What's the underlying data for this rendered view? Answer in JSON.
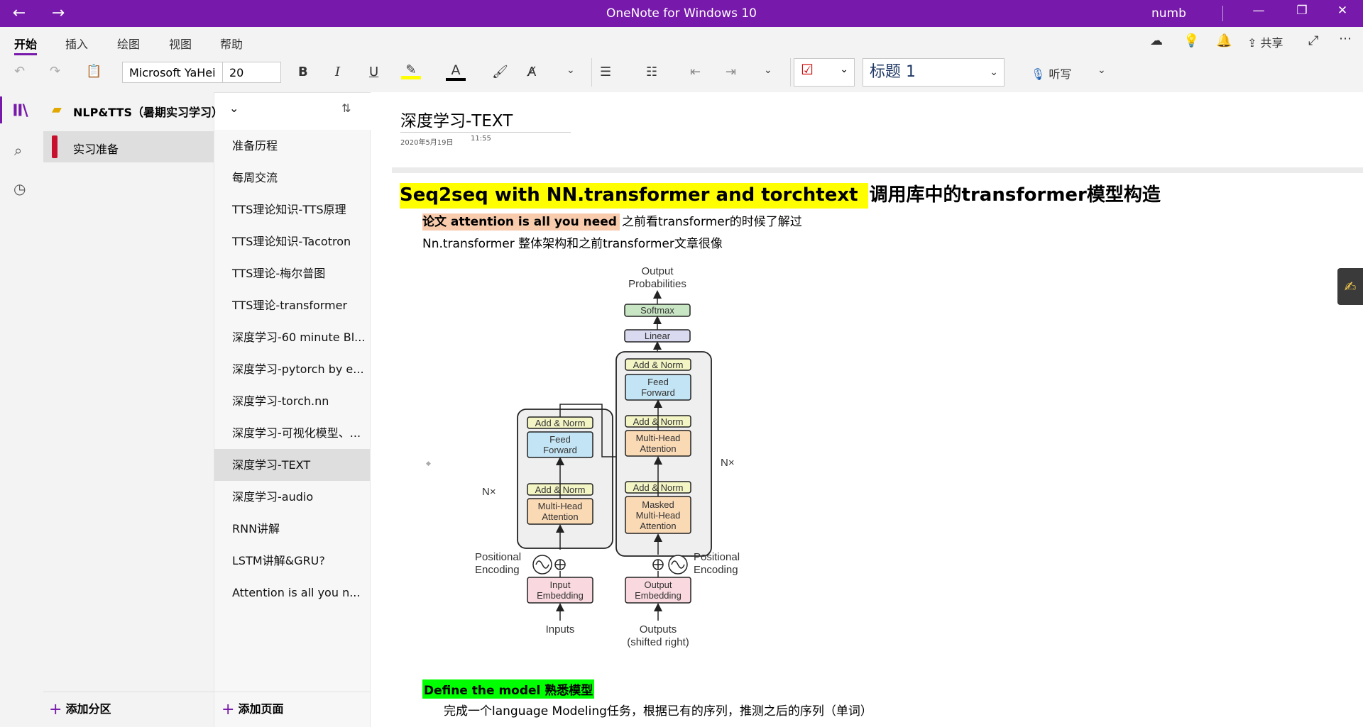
{
  "window": {
    "title": "OneNote for Windows 10",
    "user": "numb"
  },
  "ribbon": {
    "tabs": [
      "开始",
      "插入",
      "绘图",
      "视图",
      "帮助"
    ],
    "share_label": "共享",
    "font_name": "Microsoft YaHei",
    "font_size": "20",
    "style": "标题 1",
    "dictate_label": "听写"
  },
  "notebook": {
    "name": "NLP&TTS（暑期实习学习）",
    "section": "实习准备",
    "add_section_label": "添加分区",
    "add_page_label": "添加页面",
    "section_color": "#c8102e"
  },
  "pages": [
    "准备历程",
    "每周交流",
    "TTS理论知识-TTS原理",
    "TTS理论知识-Tacotron",
    "TTS理论-梅尔普图",
    "TTS理论-transformer",
    "深度学习-60 minute Bl...",
    "深度学习-pytorch by e...",
    "深度学习-torch.nn",
    "深度学习-可视化模型、...",
    "深度学习-TEXT",
    "深度学习-audio",
    "RNN讲解",
    "LSTM讲解&GRU?",
    "Attention is all you n..."
  ],
  "selected_page_index": 10,
  "note": {
    "title": "深度学习-TEXT",
    "date": "2020年5月19日",
    "time": "11:55",
    "heading_highlight": "Seq2seq with NN.transformer and torchtext",
    "heading_rest": "调用库中的transformer模型构造",
    "line1_highlight": "论文 attention is all you need",
    "line1_rest": "之前看transformer的时候了解过",
    "line2": "Nn.transformer 整体架构和之前transformer文章很像",
    "define_highlight": "Define the model 熟悉模型",
    "define_text": "完成一个language Modeling任务，根据已有的序列，推测之后的序列（单词）"
  },
  "diagram": {
    "output_prob": [
      "Output",
      "Probabilities"
    ],
    "softmax": "Softmax",
    "linear": "Linear",
    "add_norm": "Add & Norm",
    "feed_forward": [
      "Feed",
      "Forward"
    ],
    "mha": [
      "Multi-Head",
      "Attention"
    ],
    "masked_mha": [
      "Masked",
      "Multi-Head",
      "Attention"
    ],
    "nx": "N×",
    "pos_enc": [
      "Positional",
      "Encoding"
    ],
    "input_emb": [
      "Input",
      "Embedding"
    ],
    "output_emb": [
      "Output",
      "Embedding"
    ],
    "inputs": "Inputs",
    "outputs": [
      "Outputs",
      "(shifted right)"
    ]
  },
  "colors": {
    "accent": "#7719aa",
    "yellow_highlight": "#ffff00",
    "orange_highlight": "#f8cbad",
    "green_highlight": "#00ff00"
  }
}
